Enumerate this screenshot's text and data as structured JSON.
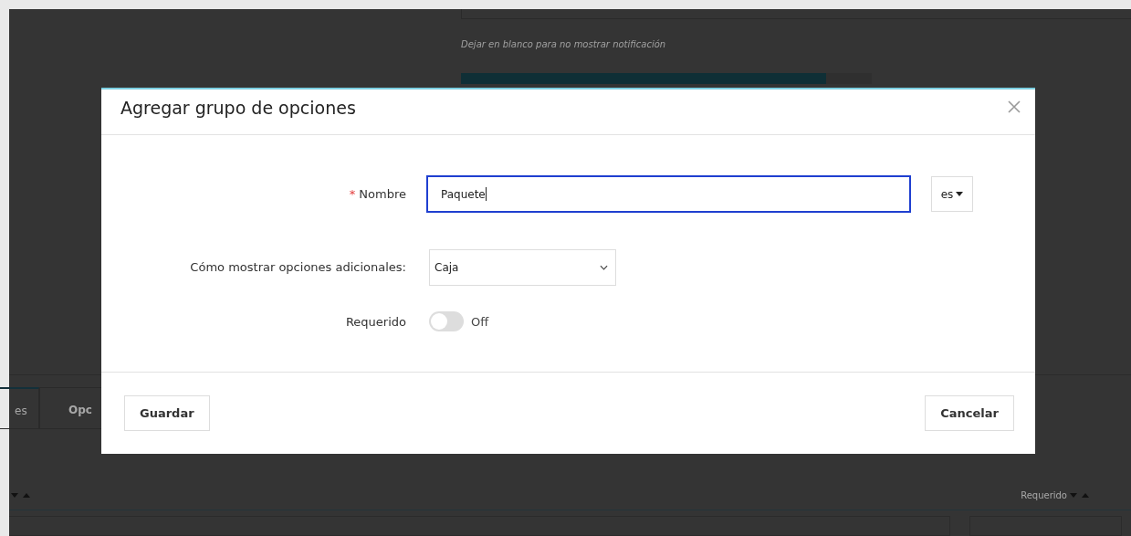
{
  "background": {
    "hint": "Dejar en blanco para no mostrar notificación",
    "tabs": [
      {
        "label": "es",
        "selected": true
      },
      {
        "label": "Opc",
        "selected": false
      }
    ],
    "columns": [
      {
        "label": "Requerido"
      }
    ]
  },
  "modal": {
    "title": "Agregar grupo de opciones",
    "fields": [
      {
        "kind": "text",
        "label": "Nombre",
        "required_mark": "*",
        "value": "Paquete",
        "focused": true,
        "lang": "es"
      },
      {
        "kind": "select",
        "label": "Cómo mostrar opciones adicionales:",
        "value": "Caja"
      },
      {
        "kind": "toggle",
        "label": "Requerido",
        "on": false,
        "state_text": "Off"
      }
    ],
    "buttons": {
      "save": "Guardar",
      "cancel": "Cancelar"
    }
  }
}
